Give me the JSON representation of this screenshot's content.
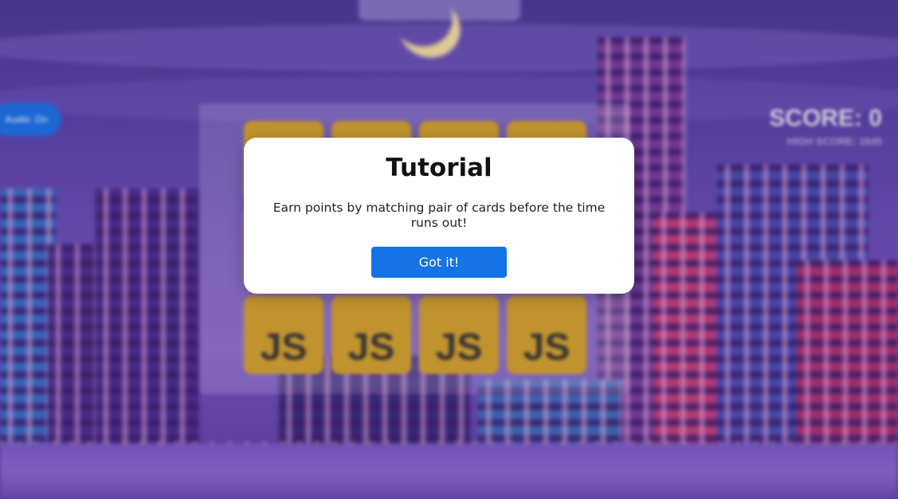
{
  "audio_button": {
    "label": "Audio: On"
  },
  "score": {
    "label": "SCORE: 0",
    "high_score_label": "HIGH SCORE: 1645"
  },
  "cards": [
    {
      "face": ""
    },
    {
      "face": ""
    },
    {
      "face": ""
    },
    {
      "face": ""
    },
    {
      "face": ""
    },
    {
      "face": ""
    },
    {
      "face": ""
    },
    {
      "face": ""
    },
    {
      "face": "JS"
    },
    {
      "face": "JS"
    },
    {
      "face": "JS"
    },
    {
      "face": "JS"
    }
  ],
  "tutorial_modal": {
    "title": "Tutorial",
    "message": "Earn points by matching pair of cards before the time runs out!",
    "button_label": "Got it!"
  },
  "colors": {
    "card": "#d6a62a",
    "primary_button": "#1473e6",
    "modal_bg": "#ffffff"
  }
}
